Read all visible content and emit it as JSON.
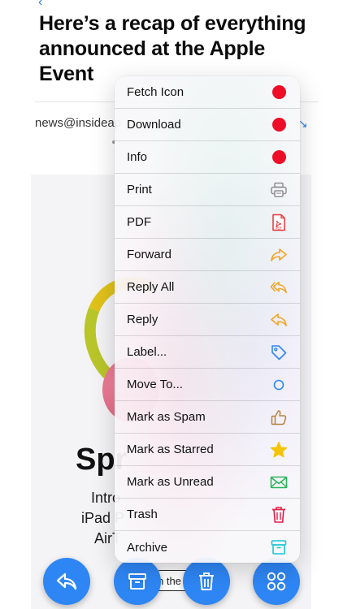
{
  "email": {
    "title": "Here’s a recap of everything announced at the Apple Event",
    "sender": "news@insideap",
    "body_big": "Spr",
    "body_lines": [
      "Intro",
      "iPad P",
      "AirT"
    ],
    "cta_label": "n the"
  },
  "context_menu": {
    "items": [
      {
        "label": "Fetch Icon",
        "icon": "red-dot-icon",
        "color": "#ee0d26"
      },
      {
        "label": "Download",
        "icon": "red-dot-icon",
        "color": "#ee0d26"
      },
      {
        "label": "Info",
        "icon": "red-dot-icon",
        "color": "#ee0d26"
      },
      {
        "label": "Print",
        "icon": "printer-icon",
        "color": "#8e8e93"
      },
      {
        "label": "PDF",
        "icon": "pdf-icon",
        "color": "#e8343a"
      },
      {
        "label": "Forward",
        "icon": "forward-arrow-icon",
        "color": "#f4a21c"
      },
      {
        "label": "Reply All",
        "icon": "reply-all-icon",
        "color": "#f4a21c"
      },
      {
        "label": "Reply",
        "icon": "reply-icon",
        "color": "#f4a21c"
      },
      {
        "label": "Label...",
        "icon": "tag-icon",
        "color": "#2e86f5"
      },
      {
        "label": "Move To...",
        "icon": "circle-icon",
        "color": "#2e86f5"
      },
      {
        "label": "Mark as Spam",
        "icon": "thumbs-up-icon",
        "color": "#b5813d"
      },
      {
        "label": "Mark as Starred",
        "icon": "star-icon",
        "color": "#f5c400"
      },
      {
        "label": "Mark as Unread",
        "icon": "envelope-icon",
        "color": "#2ab45a"
      },
      {
        "label": "Trash",
        "icon": "trash-icon",
        "color": "#e6204a"
      },
      {
        "label": "Archive",
        "icon": "archive-box-icon",
        "color": "#19c6d6"
      }
    ]
  },
  "toolbar": {
    "accent": "#2e86f5",
    "buttons": [
      "reply-icon",
      "archive-icon",
      "trash-icon",
      "grid-icon"
    ]
  }
}
